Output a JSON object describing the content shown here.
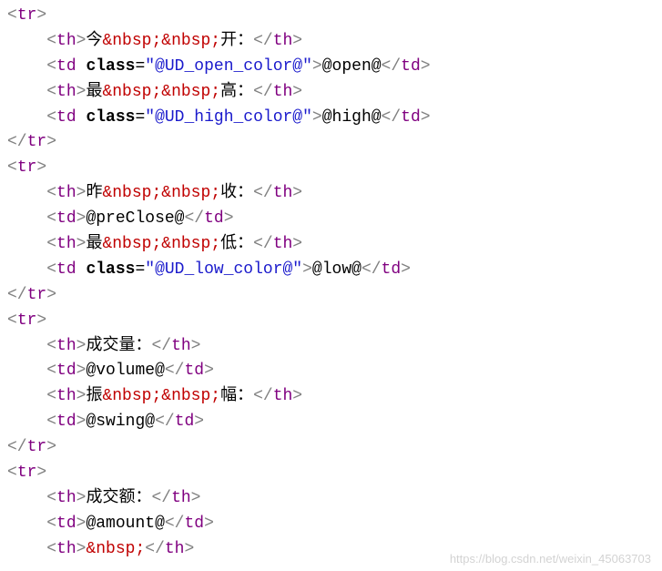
{
  "ent_nbsp": "&nbsp;",
  "lines": {
    "l1": {
      "tag": "tr"
    },
    "l2": {
      "tag": "th",
      "t1": "今",
      "t2": "开："
    },
    "l3": {
      "tag": "td",
      "attr": "class",
      "val": "\"@UD_open_color@\"",
      "text": "@open@"
    },
    "l4": {
      "tag": "th",
      "t1": "最",
      "t2": "高："
    },
    "l5": {
      "tag": "td",
      "attr": "class",
      "val": "\"@UD_high_color@\"",
      "text": "@high@"
    },
    "l6": {
      "tag": "tr"
    },
    "l7": {
      "tag": "tr"
    },
    "l8": {
      "tag": "th",
      "t1": "昨",
      "t2": "收："
    },
    "l9": {
      "tag": "td",
      "text": "@preClose@"
    },
    "l10": {
      "tag": "th",
      "t1": "最",
      "t2": "低："
    },
    "l11": {
      "tag": "td",
      "attr": "class",
      "val": "\"@UD_low_color@\"",
      "text": "@low@"
    },
    "l12": {
      "tag": "tr"
    },
    "l13": {
      "tag": "tr"
    },
    "l14": {
      "tag": "th",
      "text": "成交量："
    },
    "l15": {
      "tag": "td",
      "text": "@volume@"
    },
    "l16": {
      "tag": "th",
      "t1": "振",
      "t2": "幅："
    },
    "l17": {
      "tag": "td",
      "text": "@swing@"
    },
    "l18": {
      "tag": "tr"
    },
    "l19": {
      "tag": "tr"
    },
    "l20": {
      "tag": "th",
      "text": "成交额："
    },
    "l21": {
      "tag": "td",
      "text": "@amount@"
    },
    "l22": {
      "tag": "th"
    }
  },
  "watermark": "https://blog.csdn.net/weixin_45063703"
}
